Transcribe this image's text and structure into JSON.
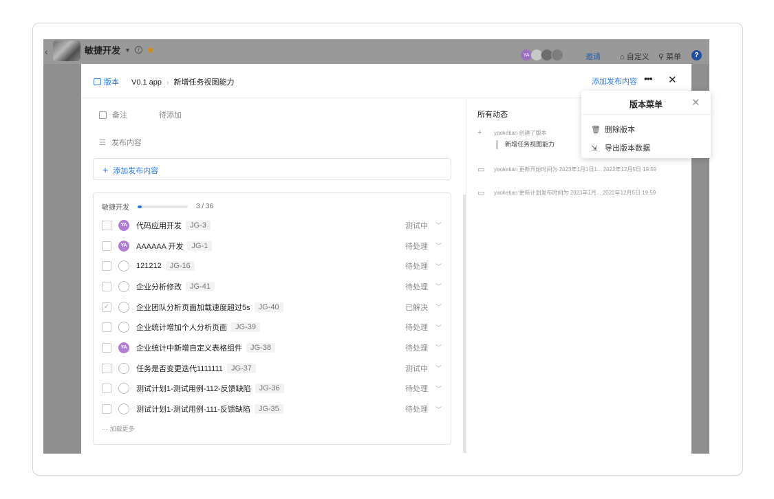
{
  "app": {
    "project_name": "敏捷开发",
    "invite": "邀请",
    "customize": "自定义",
    "menu": "菜单",
    "help": "?",
    "avatar_initials": "YA"
  },
  "modal": {
    "breadcrumb_type": "版本",
    "breadcrumb_version": "V0.1 app",
    "breadcrumb_title": "新增任务视图能力",
    "add_publish_link": "添加发布内容",
    "more": "•••",
    "close": "✕"
  },
  "left": {
    "note_label": "备注",
    "note_placeholder": "待添加",
    "publish_label": "发布内容",
    "add_content": "添加发布内容",
    "group_name": "敏捷开发",
    "progress_text": "3 / 36",
    "progress_fraction": 0.083,
    "load_more": "加载更多",
    "items": [
      {
        "title": "代码应用开发",
        "code": "JG-3",
        "status": "测试中",
        "avatar": "YA",
        "checked": false
      },
      {
        "title": "AAAAAA 开发",
        "code": "JG-1",
        "status": "待处理",
        "avatar": "YA",
        "checked": false
      },
      {
        "title": "121212",
        "code": "JG-16",
        "status": "待处理",
        "avatar": "",
        "checked": false
      },
      {
        "title": "企业分析修改",
        "code": "JG-41",
        "status": "待处理",
        "avatar": "",
        "checked": false
      },
      {
        "title": "企业团队分析页面加载速度超过5s",
        "code": "JG-40",
        "status": "已解决",
        "avatar": "",
        "checked": true
      },
      {
        "title": "企业统计增加个人分析页面",
        "code": "JG-39",
        "status": "待处理",
        "avatar": "",
        "checked": false
      },
      {
        "title": "企业统计中新增自定义表格组件",
        "code": "JG-38",
        "status": "待处理",
        "avatar": "YA",
        "checked": false
      },
      {
        "title": "任务是否变更迭代1111111",
        "code": "JG-37",
        "status": "测试中",
        "avatar": "",
        "checked": false
      },
      {
        "title": "测试计划1-测试用例-112-反馈缺陷",
        "code": "JG-36",
        "status": "待处理",
        "avatar": "",
        "checked": false
      },
      {
        "title": "测试计划1-测试用例-111-反馈缺陷",
        "code": "JG-35",
        "status": "待处理",
        "avatar": "",
        "checked": false
      }
    ]
  },
  "activity": {
    "title": "所有动态",
    "entries": [
      {
        "text": "yaoketian 创建了版本",
        "tag": "新增任务视图能力"
      },
      {
        "text": "yaoketian 更新开始时间为 2023年1月1日1...  2022年12月5日 19:59"
      },
      {
        "text": "yaoketian 更新计划发布时间为 2023年1月...  2022年12月5日 19:59"
      }
    ]
  },
  "popup": {
    "title": "版本菜单",
    "delete": "删除版本",
    "export": "导出版本数据"
  },
  "colors": {
    "accent": "#2e7ae0",
    "avatar": "#b07fd4"
  }
}
